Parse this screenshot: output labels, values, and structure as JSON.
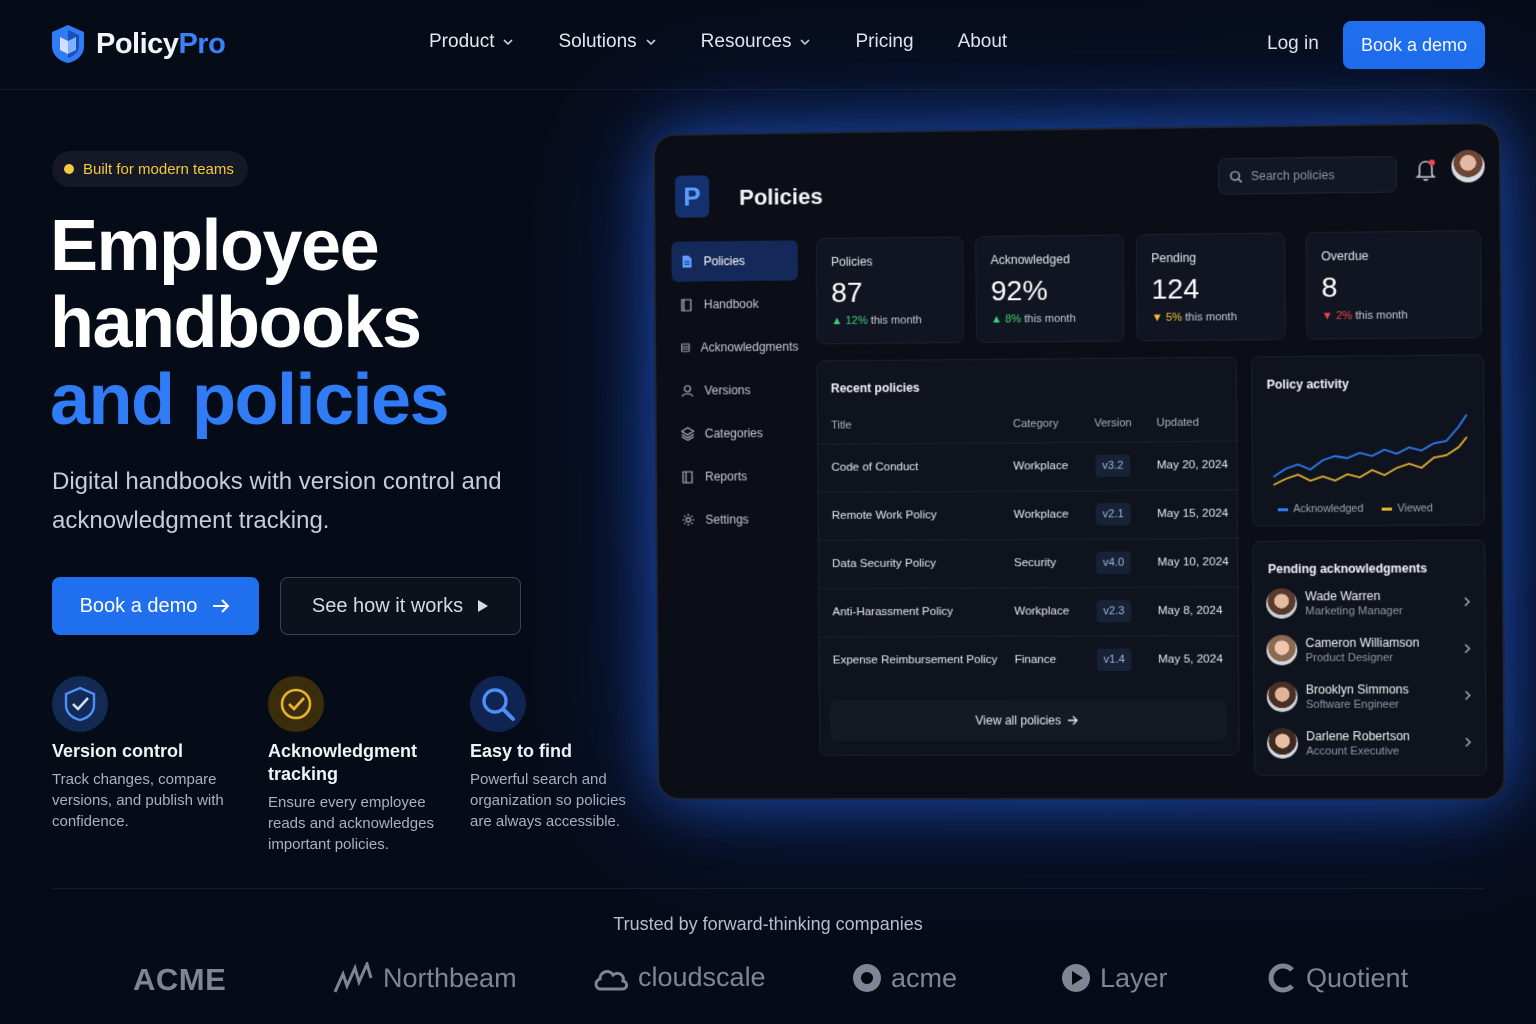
{
  "brand": {
    "name_a": "Policy",
    "name_b": "Pro",
    "accent": "#1f6fee"
  },
  "nav": {
    "items": [
      {
        "label": "Product",
        "has_dropdown": true
      },
      {
        "label": "Solutions",
        "has_dropdown": true
      },
      {
        "label": "Resources",
        "has_dropdown": true
      },
      {
        "label": "Pricing",
        "has_dropdown": false
      },
      {
        "label": "About",
        "has_dropdown": false
      }
    ],
    "login": "Log in",
    "cta": "Book a demo"
  },
  "hero": {
    "badge": "Built for modern teams",
    "title_line1": "Employee",
    "title_line2": "handbooks",
    "title_line3": "and policies",
    "subtitle": "Digital handbooks with version control and acknowledgment tracking.",
    "cta_primary": "Book a demo",
    "cta_secondary": "See how it works"
  },
  "features": [
    {
      "icon": "shield-check-icon",
      "title": "Version control",
      "desc": "Track changes, compare versions, and publish with confidence."
    },
    {
      "icon": "check-circle-icon",
      "title": "Acknowledgment tracking",
      "desc": "Ensure every employee reads and acknowledges important policies."
    },
    {
      "icon": "search-icon",
      "title": "Easy to find",
      "desc": "Powerful search and organization so policies are always accessible."
    }
  ],
  "dashboard": {
    "logo_letter": "P",
    "title": "Policies",
    "search_placeholder": "Search policies",
    "sidebar": [
      {
        "label": "Policies",
        "icon": "document-icon",
        "active": true
      },
      {
        "label": "Handbook",
        "icon": "book-icon",
        "active": false
      },
      {
        "label": "Acknowledgments",
        "icon": "list-icon",
        "active": false
      },
      {
        "label": "Versions",
        "icon": "user-icon",
        "active": false
      },
      {
        "label": "Categories",
        "icon": "layers-icon",
        "active": false
      },
      {
        "label": "Reports",
        "icon": "book-open-icon",
        "active": false
      },
      {
        "label": "Settings",
        "icon": "gear-icon",
        "active": false
      }
    ],
    "stats": [
      {
        "label": "Policies",
        "value": "87",
        "change": "12%",
        "suffix": "this month",
        "trend": "up"
      },
      {
        "label": "Acknowledged",
        "value": "92%",
        "change": "8%",
        "suffix": "this month",
        "trend": "up"
      },
      {
        "label": "Pending",
        "value": "124",
        "change": "5%",
        "suffix": "this month",
        "trend": "down-yellow"
      },
      {
        "label": "Overdue",
        "value": "8",
        "change": "2%",
        "suffix": "this month",
        "trend": "down-red"
      }
    ],
    "recent": {
      "title": "Recent policies",
      "columns": [
        "Title",
        "Category",
        "Version",
        "Updated"
      ],
      "rows": [
        {
          "title": "Code of Conduct",
          "category": "Workplace",
          "version": "v3.2",
          "updated": "May 20, 2024"
        },
        {
          "title": "Remote Work Policy",
          "category": "Workplace",
          "version": "v2.1",
          "updated": "May 15, 2024"
        },
        {
          "title": "Data Security Policy",
          "category": "Security",
          "version": "v4.0",
          "updated": "May 10, 2024"
        },
        {
          "title": "Anti-Harassment Policy",
          "category": "Workplace",
          "version": "v2.3",
          "updated": "May 8, 2024"
        },
        {
          "title": "Expense Reimbursement Policy",
          "category": "Finance",
          "version": "v1.4",
          "updated": "May 5, 2024"
        }
      ],
      "view_all": "View all policies"
    },
    "activity": {
      "title": "Policy activity",
      "legend": [
        {
          "name": "Acknowledged",
          "color": "#2f7cf6"
        },
        {
          "name": "Viewed",
          "color": "#e5b22f"
        }
      ]
    },
    "pending": {
      "title": "Pending acknowledgments",
      "people": [
        {
          "name": "Wade Warren",
          "role": "Marketing Manager"
        },
        {
          "name": "Cameron Williamson",
          "role": "Product Designer"
        },
        {
          "name": "Brooklyn Simmons",
          "role": "Software Engineer"
        },
        {
          "name": "Darlene Robertson",
          "role": "Account Executive"
        }
      ]
    }
  },
  "trusted": {
    "heading": "Trusted by forward-thinking companies",
    "logos": [
      "ACME",
      "Northbeam",
      "cloudscale",
      "acme",
      "Layer",
      "Quotient"
    ]
  }
}
